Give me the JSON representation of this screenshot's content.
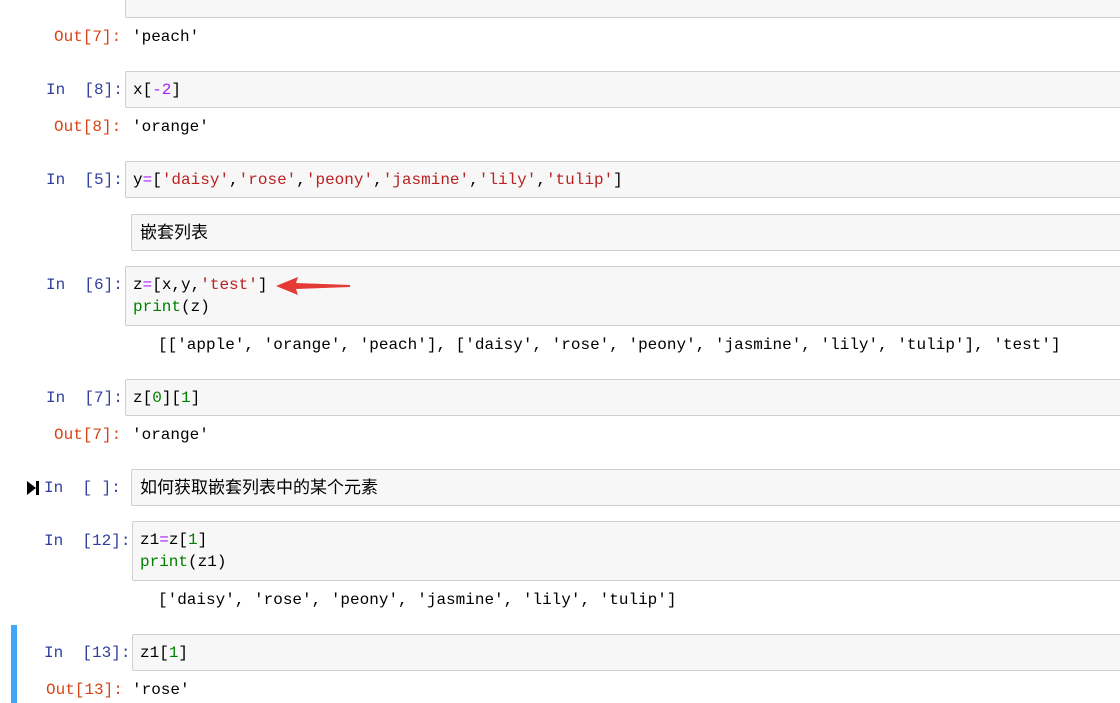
{
  "cells": {
    "c7_top": {
      "out_prompt": "Out[7]:",
      "out_text": "'peach'"
    },
    "c8": {
      "in_prompt": "In  [8]:",
      "code": [
        "x[",
        "-2",
        "]"
      ],
      "out_prompt": "Out[8]:",
      "out_text": "'orange'"
    },
    "c5": {
      "in_prompt": "In  [5]:",
      "code_var": "y",
      "code_eq": "=",
      "code_open": "[",
      "strings": [
        "'daisy'",
        "'rose'",
        "'peony'",
        "'jasmine'",
        "'lily'",
        "'tulip'"
      ],
      "code_close": "]"
    },
    "md1": {
      "text": "嵌套列表"
    },
    "c6": {
      "in_prompt": "In  [6]:",
      "line1_a": "z",
      "line1_eq": "=",
      "line1_b": "[x,y,",
      "line1_str": "'test'",
      "line1_c": "]",
      "line2_fn": "print",
      "line2_rest": "(z)",
      "output": "[['apple', 'orange', 'peach'], ['daisy', 'rose', 'peony', 'jasmine', 'lily', 'tulip'], 'test']"
    },
    "c7": {
      "in_prompt": "In  [7]:",
      "code_a": "z[",
      "code_n0": "0",
      "code_b": "][",
      "code_n1": "1",
      "code_c": "]",
      "out_prompt": "Out[7]:",
      "out_text": "'orange'"
    },
    "md2": {
      "in_prompt": "In  [ ]:",
      "text": "如何获取嵌套列表中的某个元素"
    },
    "c12": {
      "in_prompt": "In  [12]:",
      "line1_a": "z1",
      "line1_eq": "=",
      "line1_b": "z[",
      "line1_n": "1",
      "line1_c": "]",
      "line2_fn": "print",
      "line2_rest": "(z1)",
      "output": "['daisy', 'rose', 'peony', 'jasmine', 'lily', 'tulip']"
    },
    "c13": {
      "in_prompt": "In  [13]:",
      "code_a": "z1[",
      "code_n": "1",
      "code_c": "]",
      "out_prompt": "Out[13]:",
      "out_text": "'rose'"
    }
  },
  "icons": {
    "run": "run-cell-icon",
    "annotation": "red-arrow-icon"
  },
  "colors": {
    "selected_bar": "#42a5f5",
    "arrow": "#e53935",
    "in_prompt": "#303f9f",
    "out_prompt": "#d84315"
  }
}
